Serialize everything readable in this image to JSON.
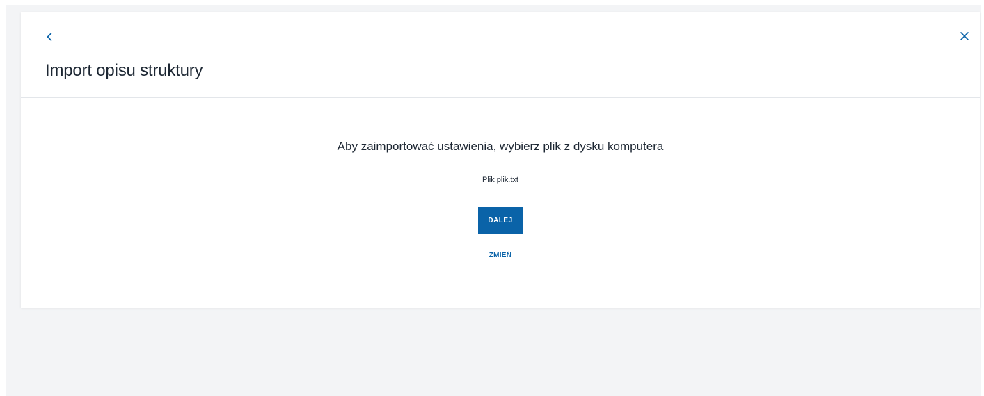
{
  "header": {
    "title": "Import opisu struktury",
    "back_icon": "chevron-left-icon",
    "close_icon": "close-icon"
  },
  "body": {
    "instruction": "Aby zaimportować ustawienia, wybierz plik z dysku komputera",
    "file_label": "Plik plik.txt",
    "next_button": "DALEJ",
    "change_link": "ZMIEŃ"
  },
  "colors": {
    "accent": "#0a63a8",
    "background": "#f3f4f6",
    "card": "#ffffff",
    "text": "#1d2733"
  }
}
